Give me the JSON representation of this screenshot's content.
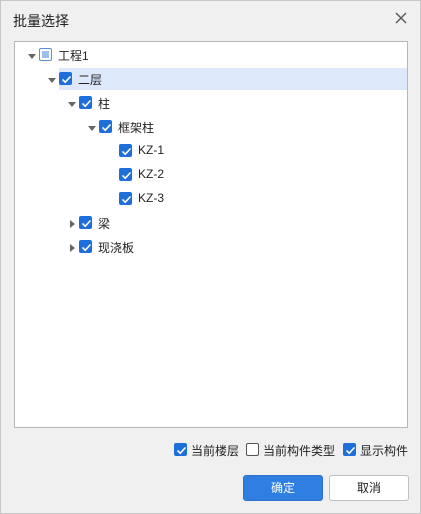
{
  "dialog": {
    "title": "批量选择",
    "close_icon": "close-icon"
  },
  "tree": {
    "nodes": [
      {
        "label": "工程1",
        "state": "partial",
        "expanded": true
      },
      {
        "label": "二层",
        "state": "checked",
        "expanded": true,
        "selected": true
      },
      {
        "label": "柱",
        "state": "checked",
        "expanded": true
      },
      {
        "label": "框架柱",
        "state": "checked",
        "expanded": true
      },
      {
        "label": "KZ-1",
        "state": "checked",
        "leaf": true
      },
      {
        "label": "KZ-2",
        "state": "checked",
        "leaf": true
      },
      {
        "label": "KZ-3",
        "state": "checked",
        "leaf": true
      },
      {
        "label": "梁",
        "state": "checked",
        "expanded": false
      },
      {
        "label": "现浇板",
        "state": "checked",
        "expanded": false
      }
    ]
  },
  "options": {
    "current_floor": {
      "label": "当前楼层",
      "checked": true
    },
    "current_component_type": {
      "label": "当前构件类型",
      "checked": false
    },
    "show_components": {
      "label": "显示构件",
      "checked": true
    }
  },
  "buttons": {
    "ok": "确定",
    "cancel": "取消"
  },
  "colors": {
    "accent": "#1e6fd9",
    "selection": "#dde8fb",
    "primary_button": "#2f7ee2"
  }
}
